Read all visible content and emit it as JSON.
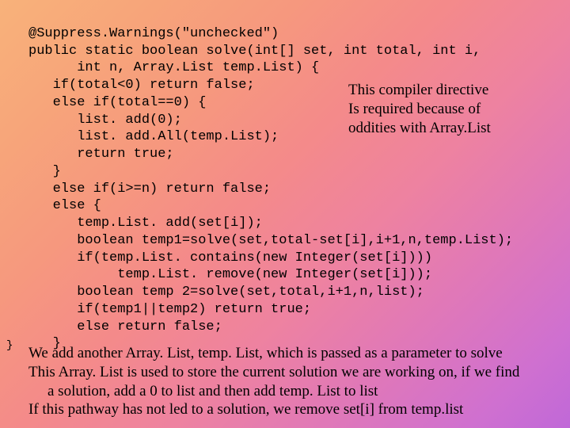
{
  "code": {
    "l1": "@Suppress.Warnings(\"unchecked\")",
    "l2": "public static boolean solve(int[] set, int total, int i,",
    "l3": "      int n, Array.List temp.List) {",
    "l4": "   if(total<0) return false;",
    "l5": "   else if(total==0) {",
    "l6": "      list. add(0);",
    "l7": "      list. add.All(temp.List);",
    "l8": "      return true;",
    "l9": "   }",
    "l10": "   else if(i>=n) return false;",
    "l11": "   else {",
    "l12": "      temp.List. add(set[i]);",
    "l13": "      boolean temp1=solve(set,total-set[i],i+1,n,temp.List);",
    "l14": "      if(temp.List. contains(new Integer(set[i])))",
    "l15": "           temp.List. remove(new Integer(set[i]));",
    "l16": "      boolean temp 2=solve(set,total,i+1,n,list);",
    "l17": "      if(temp1||temp2) return true;",
    "l18": "      else return false;",
    "l19": "   }"
  },
  "closing_brace": "}",
  "annotation": {
    "a1": "This compiler directive",
    "a2": "Is required because of",
    "a3": "oddities with Array.List"
  },
  "explanation": {
    "e1": "We add another Array. List, temp. List, which is passed as a parameter to solve",
    "e2": "This Array. List is used to store the current solution we are working on, if we find",
    "e3": "a solution, add a 0 to list and then add temp. List to list",
    "e4": "If this pathway has not led to a solution, we remove set[i] from temp.list"
  }
}
